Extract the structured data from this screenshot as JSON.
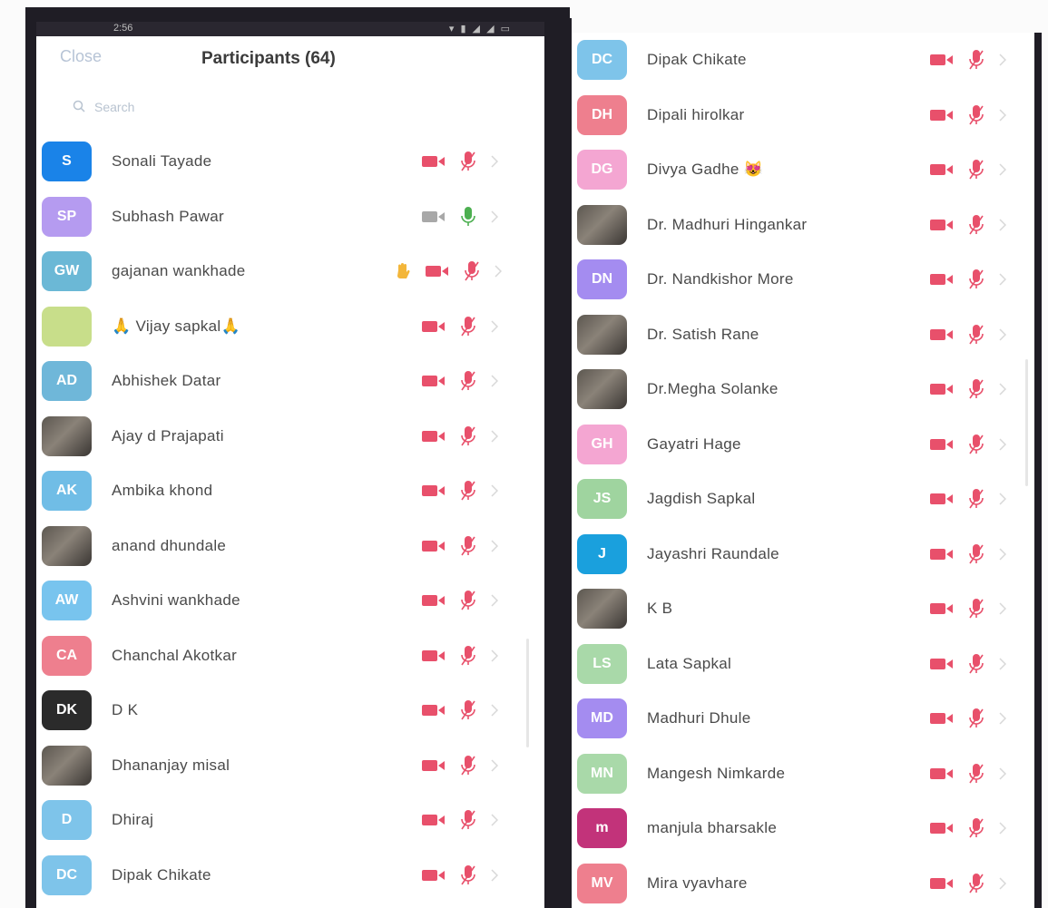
{
  "status_bar": {
    "time": "2:56",
    "icons_text": ""
  },
  "header": {
    "close_label": "Close",
    "title": "Participants (64)"
  },
  "search": {
    "placeholder": "Search"
  },
  "colors": {
    "muted_red": "#e8506b",
    "cam_gray": "#a8a8a8",
    "mic_green": "#4caf50",
    "hand_yellow": "#f3b63a"
  },
  "left_participants": [
    {
      "initials": "S",
      "name": "Sonali Tayade",
      "avatar_color": "#1a83e8",
      "video": "muted",
      "mic": "muted"
    },
    {
      "initials": "SP",
      "name": "Subhash Pawar",
      "avatar_color": "#b59bf0",
      "video": "off",
      "mic": "on"
    },
    {
      "initials": "GW",
      "name": "gajanan wankhade",
      "avatar_color": "#6bb8d6",
      "video": "muted",
      "mic": "muted",
      "hand_raised": true
    },
    {
      "initials": "",
      "name": "🙏 Vijay sapkal🙏",
      "avatar_color": "#c8de8a",
      "video": "muted",
      "mic": "muted"
    },
    {
      "initials": "AD",
      "name": "Abhishek Datar",
      "avatar_color": "#6fb7d9",
      "video": "muted",
      "mic": "muted"
    },
    {
      "initials": "",
      "name": "Ajay d Prajapati",
      "avatar_color": "#3a5fa8",
      "photo": true,
      "video": "muted",
      "mic": "muted"
    },
    {
      "initials": "AK",
      "name": "Ambika khond",
      "avatar_color": "#70bde6",
      "video": "muted",
      "mic": "muted"
    },
    {
      "initials": "",
      "name": "anand dhundale",
      "avatar_color": "#6b5f50",
      "photo": true,
      "video": "muted",
      "mic": "muted"
    },
    {
      "initials": "AW",
      "name": "Ashvini wankhade",
      "avatar_color": "#78c4ee",
      "video": "muted",
      "mic": "muted"
    },
    {
      "initials": "CA",
      "name": "Chanchal Akotkar",
      "avatar_color": "#ee7f8e",
      "video": "muted",
      "mic": "muted"
    },
    {
      "initials": "DK",
      "name": "D K",
      "avatar_color": "#2b2b2b",
      "video": "muted",
      "mic": "muted"
    },
    {
      "initials": "",
      "name": "Dhananjay misal",
      "avatar_color": "#5a5560",
      "photo": true,
      "video": "muted",
      "mic": "muted"
    },
    {
      "initials": "D",
      "name": "Dhiraj",
      "avatar_color": "#7ec4ea",
      "video": "muted",
      "mic": "muted"
    },
    {
      "initials": "DC",
      "name": "Dipak Chikate",
      "avatar_color": "#7ec4ea",
      "video": "muted",
      "mic": "muted"
    }
  ],
  "right_participants": [
    {
      "initials": "DC",
      "name": "Dipak Chikate",
      "avatar_color": "#7ec4ea",
      "video": "muted",
      "mic": "muted"
    },
    {
      "initials": "DH",
      "name": "Dipali hirolkar",
      "avatar_color": "#ee7f8e",
      "video": "muted",
      "mic": "muted"
    },
    {
      "initials": "DG",
      "name": "Divya Gadhe 😻",
      "avatar_color": "#f4a6d2",
      "video": "muted",
      "mic": "muted"
    },
    {
      "initials": "",
      "name": "Dr. Madhuri Hingankar",
      "avatar_color": "#6a5d55",
      "photo": true,
      "video": "muted",
      "mic": "muted"
    },
    {
      "initials": "DN",
      "name": "Dr. Nandkishor More",
      "avatar_color": "#a48cf0",
      "video": "muted",
      "mic": "muted"
    },
    {
      "initials": "",
      "name": "Dr. Satish Rane",
      "avatar_color": "#6a3b35",
      "photo": true,
      "video": "muted",
      "mic": "muted"
    },
    {
      "initials": "",
      "name": "Dr.Megha Solanke",
      "avatar_color": "#5a4a45",
      "photo": true,
      "video": "muted",
      "mic": "muted"
    },
    {
      "initials": "GH",
      "name": "Gayatri Hage",
      "avatar_color": "#f4a6d2",
      "video": "muted",
      "mic": "muted"
    },
    {
      "initials": "JS",
      "name": "Jagdish Sapkal",
      "avatar_color": "#9fd49f",
      "video": "muted",
      "mic": "muted"
    },
    {
      "initials": "J",
      "name": "Jayashri Raundale",
      "avatar_color": "#1aa0dd",
      "video": "muted",
      "mic": "muted"
    },
    {
      "initials": "",
      "name": "K B",
      "avatar_color": "#3f6fa3",
      "photo": true,
      "video": "muted",
      "mic": "muted"
    },
    {
      "initials": "LS",
      "name": "Lata Sapkal",
      "avatar_color": "#a9d9a9",
      "video": "muted",
      "mic": "muted"
    },
    {
      "initials": "MD",
      "name": "Madhuri Dhule",
      "avatar_color": "#a48cf0",
      "video": "muted",
      "mic": "muted"
    },
    {
      "initials": "MN",
      "name": "Mangesh Nimkarde",
      "avatar_color": "#a9d9a9",
      "video": "muted",
      "mic": "muted"
    },
    {
      "initials": "m",
      "name": "manjula bharsakle",
      "avatar_color": "#c2337a",
      "video": "muted",
      "mic": "muted"
    },
    {
      "initials": "MV",
      "name": "Mira vyavhare",
      "avatar_color": "#ee7f8e",
      "video": "muted",
      "mic": "muted"
    }
  ]
}
